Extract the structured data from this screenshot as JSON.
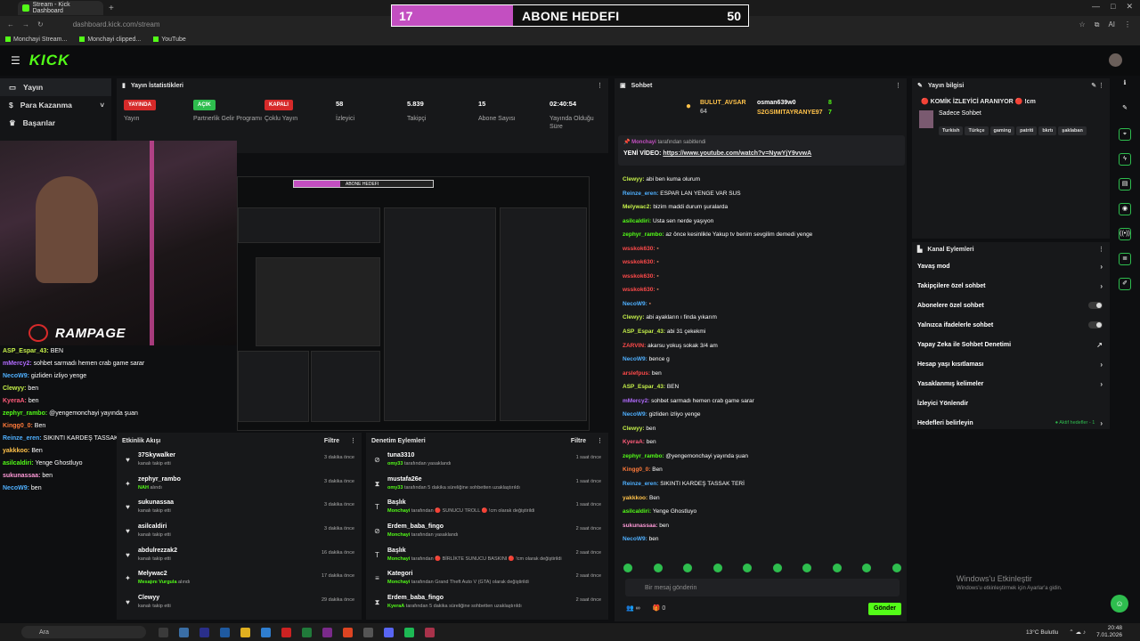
{
  "browser": {
    "tab_title": "Stream - Kick Dashboard",
    "new_tab": "+",
    "url": "dashboard.kick.com/stream",
    "bookmarks": [
      "Monchayi Stream...",
      "Monchayi clipped...",
      "YouTube"
    ],
    "extension_label": "AI"
  },
  "goal_overlay": {
    "current": "17",
    "title": "ABONE HEDEFI",
    "target": "50",
    "progress_fraction": 0.34,
    "fill_color": "#c34fc1"
  },
  "kick": {
    "logo": "KICK",
    "accent_color": "#53fc18"
  },
  "sidebar": {
    "items": [
      {
        "label": "Yayın",
        "icon": "video-icon",
        "active": true
      },
      {
        "label": "Para Kazanma",
        "icon": "money-icon",
        "chevron": "˅"
      },
      {
        "label": "Başarılar",
        "icon": "trophy-icon"
      }
    ]
  },
  "webcam": {
    "brand": "RAMPAGE"
  },
  "overlay_chat": [
    {
      "user": "ASP_Espar_43:",
      "msg": "BEN",
      "color": "#c5f04a"
    },
    {
      "user": "mMercy2:",
      "msg": "sohbet sarmadı hemen crab game sarar",
      "color": "#b26bff"
    },
    {
      "user": "NecoW9:",
      "msg": "gizliden izliyo yenge",
      "color": "#4fb0ff"
    },
    {
      "user": "Clewyy:",
      "msg": "ben",
      "color": "#c5f04a"
    },
    {
      "user": "KyeraA:",
      "msg": "ben",
      "color": "#ff5c7a"
    },
    {
      "user": "zephyr_rambo:",
      "msg": "@yengemonchayi yayında şuan",
      "color": "#53fc18"
    },
    {
      "user": "Kingg0_0:",
      "msg": "Ben",
      "color": "#ff7a3a"
    },
    {
      "user": "Reinze_eren:",
      "msg": "SIKINTI KARDEŞ TASSAK TERİ",
      "color": "#4fb0ff"
    },
    {
      "user": "yakkkoo:",
      "msg": "Ben",
      "color": "#ffc24a"
    },
    {
      "user": "asilcaldiri:",
      "msg": "Yenge Ghostluyo",
      "color": "#53fc18"
    },
    {
      "user": "sukunassaa:",
      "msg": "ben",
      "color": "#ff9ad8"
    },
    {
      "user": "NecoW9:",
      "msg": "ben",
      "color": "#4fb0ff"
    }
  ],
  "stats": {
    "title": "Yayın İstatistikleri",
    "cells": [
      {
        "badge": "YAYINDA",
        "badge_color": "#d62a2a",
        "label": "Yayın"
      },
      {
        "badge": "AÇIK",
        "badge_color": "#2ebd4e",
        "label": "Partnerlik Gelir Programı"
      },
      {
        "badge": "KAPALI",
        "badge_color": "#d62a2a",
        "label": "Çoklu Yayın"
      },
      {
        "value": "58",
        "label": "İzleyici"
      },
      {
        "value": "5.839",
        "label": "Takipçi"
      },
      {
        "value": "15",
        "label": "Abone Sayısı"
      },
      {
        "value": "02:40:54",
        "label": "Yayında Olduğu Süre"
      }
    ]
  },
  "preview": {
    "mini_goal_current": "17",
    "mini_goal_title": "ABONE HEDEFI",
    "mini_goal_target": "50"
  },
  "activity": {
    "title": "Etkinlik Akışı",
    "filter": "Filtre",
    "rows": [
      {
        "name": "37Skywalker",
        "sub": "kanalı takip etti",
        "time": "3 dakika önce",
        "icon": "heart-icon"
      },
      {
        "name": "zephyr_rambo",
        "sub_highlight": "NAH",
        "sub": " alındı",
        "time": "3 dakika önce",
        "icon": "gift-icon"
      },
      {
        "name": "sukunassaa",
        "sub": "kanalı takip etti",
        "time": "3 dakika önce",
        "icon": "heart-icon"
      },
      {
        "name": "asilcaldiri",
        "sub": "kanalı takip etti",
        "time": "3 dakika önce",
        "icon": "heart-icon"
      },
      {
        "name": "abdulrezzak2",
        "sub": "kanalı takip etti",
        "time": "16 dakika önce",
        "icon": "heart-icon"
      },
      {
        "name": "Melywac2",
        "sub_highlight": "Mesajını Vurgula",
        "sub": " alındı",
        "time": "17 dakika önce",
        "icon": "gift-icon"
      },
      {
        "name": "Clewyy",
        "sub": "kanalı takip etti",
        "time": "29 dakika önce",
        "icon": "heart-icon"
      }
    ]
  },
  "moderation": {
    "title": "Denetim Eylemleri",
    "filter": "Filtre",
    "rows": [
      {
        "name": "tuna3310",
        "sub_highlight": "omy33",
        "sub": " tarafından yasaklandı",
        "time": "1 saat önce",
        "icon": "ban-icon"
      },
      {
        "name": "mustafa26e",
        "sub_highlight": "omy33",
        "sub": " tarafından 5 dakika süreliğine sohbetten uzaklaştırıldı",
        "time": "1 saat önce",
        "icon": "hourglass-icon"
      },
      {
        "name": "Başlık",
        "sub_highlight": "Monchayi",
        "sub": " tarafından 🔴 SUNUCU TROLL 🔴 !cm olarak değiştirildi",
        "time": "1 saat önce",
        "icon": "text-icon"
      },
      {
        "name": "Erdem_baba_fingo",
        "sub_highlight": "Monchayi",
        "sub": " tarafından yasaklandı",
        "time": "2 saat önce",
        "icon": "ban-icon"
      },
      {
        "name": "Başlık",
        "sub_highlight": "Monchayi",
        "sub": " tarafından 🔴 BİRLİKTE SUNUCU BASKINI 🔴 !cm olarak değiştirildi",
        "time": "2 saat önce",
        "icon": "text-icon"
      },
      {
        "name": "Kategori",
        "sub_highlight": "Monchayi",
        "sub": " tarafından Grand Theft Auto V (GTA) olarak değiştirildi",
        "time": "2 saat önce",
        "icon": "list-icon"
      },
      {
        "name": "Erdem_baba_fingo",
        "sub_highlight": "KyeraA",
        "sub": " tarafından 5 dakika süreliğine sohbetten uzaklaştırıldı",
        "time": "2 saat önce",
        "icon": "hourglass-icon"
      }
    ]
  },
  "chat": {
    "title": "Sohbet",
    "gifters": [
      {
        "name": "BULUT_AVSAR",
        "count": "64",
        "color": "#ffc24a"
      },
      {
        "name": "osman639w0",
        "count": "8",
        "color": "#ffffff"
      },
      {
        "name": "S2GSIMITAYRANYE97",
        "count": "7",
        "color": "#ffc24a"
      }
    ],
    "pinned_by": "Monchayi",
    "pinned_suffix": " tarafından sabitlendi",
    "pinned_prefix": "YENİ VİDEO: ",
    "pinned_link": "https://www.youtube.com/watch?v=NywYjY9vvwA",
    "messages": [
      {
        "user": "Clewyy:",
        "msg": "abi ben kuma olurum",
        "color": "#c5f04a"
      },
      {
        "user": "Reinze_eren:",
        "msg": "ESPAR LAN YENGE VAR SUS",
        "color": "#4fb0ff"
      },
      {
        "user": "Melywac2:",
        "msg": "bizim maddi durum şuralarda",
        "color": "#c5f04a"
      },
      {
        "user": "asilcaldiri:",
        "msg": "Usta sen nerde yaşıyon",
        "color": "#53fc18"
      },
      {
        "user": "zephyr_rambo:",
        "msg": "az önce kesinlikle Yakup tv benim sevgilim demedi yenge",
        "color": "#53fc18"
      },
      {
        "user": "wsskok630:",
        "msg": "▪",
        "color": "#ff4a4a"
      },
      {
        "user": "wsskok630:",
        "msg": "▪",
        "color": "#ff4a4a"
      },
      {
        "user": "wsskok630:",
        "msg": "▪",
        "color": "#ff4a4a"
      },
      {
        "user": "wsskok630:",
        "msg": "▪",
        "color": "#ff4a4a"
      },
      {
        "user": "NecoW9:",
        "msg": "▪",
        "color": "#4fb0ff"
      },
      {
        "user": "Clewyy:",
        "msg": "abi ayakların ı finda yıkarım",
        "color": "#c5f04a"
      },
      {
        "user": "ASP_Espar_43:",
        "msg": "abi 31 çekekmi",
        "color": "#c5f04a"
      },
      {
        "user": "ZARVIN:",
        "msg": "akarsu yokuş sokak 3/4 am",
        "color": "#ff4a4a"
      },
      {
        "user": "NecoW9:",
        "msg": "bence g",
        "color": "#4fb0ff"
      },
      {
        "user": "arslefpus:",
        "msg": "ben",
        "color": "#ff4a4a"
      },
      {
        "user": "ASP_Espar_43:",
        "msg": "BEN",
        "color": "#c5f04a"
      },
      {
        "user": "mMercy2:",
        "msg": "sohbet sarmadı hemen crab game sarar",
        "color": "#b26bff"
      },
      {
        "user": "NecoW9:",
        "msg": "gizliden izliyo yenge",
        "color": "#4fb0ff"
      },
      {
        "user": "Clewyy:",
        "msg": "ben",
        "color": "#c5f04a"
      },
      {
        "user": "KyeraA:",
        "msg": "ben",
        "color": "#ff5c7a"
      },
      {
        "user": "zephyr_rambo:",
        "msg": "@yengemonchayi yayında şuan",
        "color": "#53fc18"
      },
      {
        "user": "Kingg0_0:",
        "msg": "Ben",
        "color": "#ff7a3a"
      },
      {
        "user": "Reinze_eren:",
        "msg": "SIKINTI KARDEŞ TASSAK TERİ",
        "color": "#4fb0ff"
      },
      {
        "user": "yakkkoo:",
        "msg": "Ben",
        "color": "#ffc24a"
      },
      {
        "user": "asilcaldiri:",
        "msg": "Yenge Ghostluyo",
        "color": "#53fc18"
      },
      {
        "user": "sukunassaa:",
        "msg": "ben",
        "color": "#ff9ad8"
      },
      {
        "user": "NecoW9:",
        "msg": "ben",
        "color": "#4fb0ff"
      }
    ],
    "input_placeholder": "Bir mesaj gönderin",
    "send_label": "Gönder",
    "footer_counts": [
      "∞",
      "0"
    ]
  },
  "stream_info": {
    "title": "Yayın bilgisi",
    "stream_title": "🔴 KOMİK İZLEYİCİ ARANIYOR 🔴 !cm",
    "category": "Sadece Sohbet",
    "tags": [
      "Turkish",
      "Türkçe",
      "gaming",
      "patriti",
      "bkrtı",
      "şaklaban"
    ]
  },
  "channel_actions": {
    "title": "Kanal Eylemleri",
    "rows": [
      {
        "label": "Yavaş mod",
        "control": "chevron"
      },
      {
        "label": "Takipçilere özel sohbet",
        "control": "chevron"
      },
      {
        "label": "Abonelere özel sohbet",
        "control": "toggle"
      },
      {
        "label": "Yalnızca ifadelerle sohbet",
        "control": "toggle"
      },
      {
        "label": "Yapay Zeka ile Sohbet Denetimi",
        "control": "external"
      },
      {
        "label": "Hesap yaşı kısıtlaması",
        "control": "chevron"
      },
      {
        "label": "Yasaklanmış kelimeler",
        "control": "chevron"
      },
      {
        "label": "İzleyici Yönlendir",
        "control": "none"
      },
      {
        "label": "Hedefleri belirleyin",
        "control": "chevron",
        "extra": "● Aktif hedefler - 1"
      }
    ]
  },
  "windows": {
    "activate_title": "Windows'u Etkinleştir",
    "activate_sub": "Windows'u etkinleştirmek için Ayarlar'a gidin.",
    "search": "Ara",
    "weather": "13°C  Bulutlu",
    "time": "20:48",
    "date": "7.01.2026"
  }
}
